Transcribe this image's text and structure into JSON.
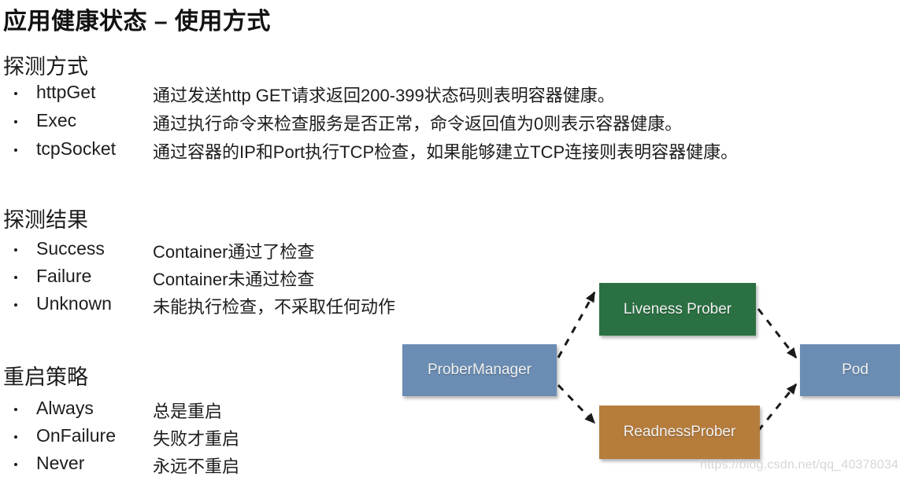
{
  "slide": {
    "title": "应用健康状态 – 使用方式"
  },
  "sections": {
    "probe_type": {
      "heading": "探测方式",
      "items": [
        {
          "term": "httpGet",
          "desc": "通过发送http GET请求返回200-399状态码则表明容器健康。"
        },
        {
          "term": "Exec",
          "desc": "通过执行命令来检查服务是否正常，命令返回值为0则表示容器健康。"
        },
        {
          "term": "tcpSocket",
          "desc": "通过容器的IP和Port执行TCP检查，如果能够建立TCP连接则表明容器健康。"
        }
      ]
    },
    "probe_result": {
      "heading": "探测结果",
      "items": [
        {
          "term": "Success",
          "desc": "Container通过了检查"
        },
        {
          "term": "Failure",
          "desc": "Container未通过检查"
        },
        {
          "term": "Unknown",
          "desc": "未能执行检查，不采取任何动作"
        }
      ]
    },
    "restart_policy": {
      "heading": "重启策略",
      "items": [
        {
          "term": "Always",
          "desc": "总是重启"
        },
        {
          "term": "OnFailure",
          "desc": "失败才重启"
        },
        {
          "term": "Never",
          "desc": "永远不重启"
        }
      ]
    }
  },
  "diagram": {
    "nodes": {
      "prober_manager": {
        "label": "ProberManager",
        "color": "#6b8db3"
      },
      "liveness_prober": {
        "label": "Liveness Prober",
        "color": "#2b7042"
      },
      "readness_prober": {
        "label": "ReadnessProber",
        "color": "#b67c3c"
      },
      "pod": {
        "label": "Pod",
        "color": "#6b8db3"
      }
    },
    "edges": [
      {
        "from": "prober_manager",
        "to": "liveness_prober",
        "style": "dashed"
      },
      {
        "from": "prober_manager",
        "to": "readness_prober",
        "style": "dashed"
      },
      {
        "from": "liveness_prober",
        "to": "pod",
        "style": "dashed"
      },
      {
        "from": "readness_prober",
        "to": "pod",
        "style": "dashed"
      }
    ],
    "edge_color": "#1a1a1a"
  },
  "watermark": {
    "text": "https://blog.csdn.net/qq_40378034"
  }
}
